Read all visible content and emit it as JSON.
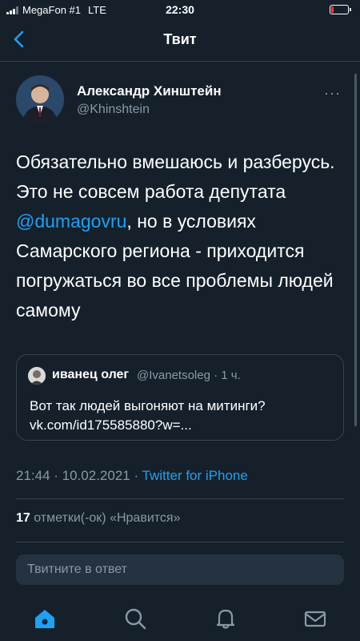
{
  "status_bar": {
    "carrier": "MegaFon #1",
    "network": "LTE",
    "time": "22:30",
    "signal_bars_active": 3,
    "battery_level": 0.1
  },
  "header": {
    "title": "Твит"
  },
  "tweet": {
    "author_name": "Александр Хинштейн",
    "author_handle": "@Khinshtein",
    "more_label": "···",
    "text_before": "Обязательно вмешаюсь и разберусь. Это не совсем работа депутата ",
    "mention": "@dumagovru",
    "text_after": ", но в условиях Самарского региона - приходится погружаться во все проблемы людей самому",
    "timestamp": "21:44 · 10.02.2021 · ",
    "source": "Twitter for iPhone",
    "likes_count": "17",
    "likes_label": " отметки(-ок) «Нравится»"
  },
  "quote": {
    "name": "иванец олег",
    "handle_time": "@Ivanetsoleg · 1 ч.",
    "text_line1": "Вот так людей выгоняют на митинги?",
    "text_line2": "vk.com/id175585880?w=..."
  },
  "reply": {
    "placeholder": "Твитните в ответ"
  },
  "colors": {
    "background": "#15202b",
    "accent": "#1da1f2",
    "secondary_text": "#8899a6",
    "border": "#38444d"
  },
  "icons": {
    "back": "chevron-left-icon",
    "home": "home-icon",
    "search": "search-icon",
    "notifications": "bell-icon",
    "messages": "mail-icon"
  }
}
